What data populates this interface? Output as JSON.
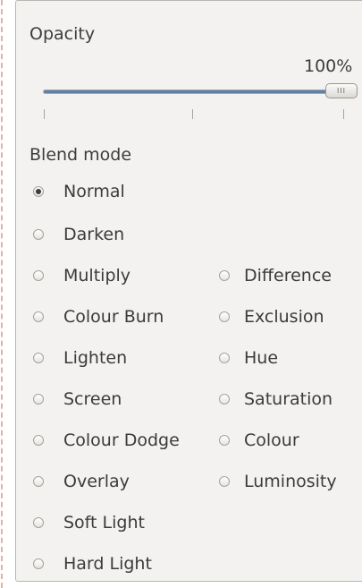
{
  "opacity": {
    "label": "Opacity",
    "value_text": "100%",
    "value": 100,
    "handle_grip": "III"
  },
  "blend_mode": {
    "label": "Blend mode",
    "selected": "Normal",
    "left_column": [
      "Normal",
      "Darken",
      "Multiply",
      "Colour Burn",
      "Lighten",
      "Screen",
      "Colour Dodge",
      "Overlay",
      "Soft Light",
      "Hard Light"
    ],
    "right_column": [
      "Difference",
      "Exclusion",
      "Hue",
      "Saturation",
      "Colour",
      "Luminosity"
    ]
  },
  "colors": {
    "slider_fill": "#5d7fa8",
    "panel_background": "#f3f2f0",
    "dashed_border": "#e3b2a6"
  }
}
